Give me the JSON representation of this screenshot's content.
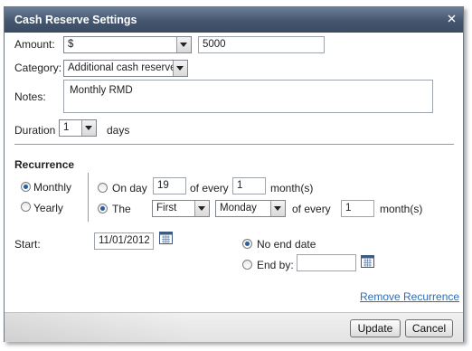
{
  "dialog": {
    "title": "Cash Reserve Settings",
    "close_icon": "close-icon"
  },
  "amount": {
    "label": "Amount:",
    "currency_value": "$",
    "value": "5000"
  },
  "category": {
    "label": "Category:",
    "value": "Additional cash reserve"
  },
  "notes": {
    "label": "Notes:",
    "value": "Monthly RMD"
  },
  "duration": {
    "label": "Duration",
    "value": "1",
    "unit": "days"
  },
  "recurrence": {
    "heading": "Recurrence",
    "monthly_label": "Monthly",
    "yearly_label": "Yearly",
    "selected": "Monthly",
    "on_day": {
      "label": "On day",
      "day_value": "19",
      "of_every_label": "of every",
      "months_value": "1",
      "unit": "month(s)"
    },
    "the": {
      "label": "The",
      "ordinal_value": "First",
      "weekday_value": "Monday",
      "of_every_label": "of every",
      "months_value": "1",
      "unit": "month(s)"
    },
    "option_selected": "The"
  },
  "start": {
    "label": "Start:",
    "value": "11/01/2012"
  },
  "end": {
    "no_end_label": "No end date",
    "end_by_label": "End by:",
    "end_by_value": "",
    "selected": "No end date"
  },
  "links": {
    "remove_recurrence": "Remove Recurrence"
  },
  "buttons": {
    "update": "Update",
    "cancel": "Cancel"
  },
  "colors": {
    "title_bar": "#44566e",
    "link": "#2e6bb5",
    "radio_selected": "#2a5d9c"
  }
}
